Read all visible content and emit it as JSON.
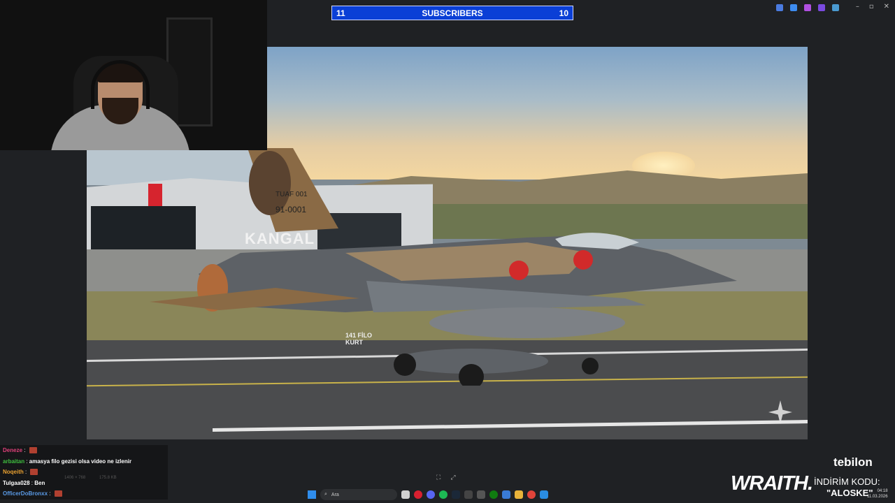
{
  "subscriber_bar": {
    "left_value": "11",
    "title": "SUBSCRIBERS",
    "right_value": "10",
    "bg_color": "#0a3fd6"
  },
  "top_icons": [
    "app-icon",
    "app-icon",
    "app-icon",
    "app-icon",
    "app-icon"
  ],
  "window_controls": {
    "minimize": "–",
    "maximize": "▫",
    "close": "✕"
  },
  "photo": {
    "tail_text_1": "TUAF 001",
    "tail_text_2": "91-0001",
    "nose_name": "KANGAL",
    "squadron_text_1": "141 FİLO",
    "squadron_text_2": "KURT"
  },
  "chat": {
    "messages": [
      {
        "user": "Deneze",
        "user_color": "#e0407a",
        "text": "",
        "emote": true
      },
      {
        "user": "arbaitan",
        "user_color": "#3fbf3f",
        "text": "amasya filo gezisi olsa video ne izlenir",
        "emote": false
      },
      {
        "user": "Noqeith",
        "user_color": "#e8a030",
        "text": "",
        "emote": true
      },
      {
        "user": "Tulgaa028",
        "user_color": "#ffffff",
        "text": "Ben",
        "emote": false
      },
      {
        "user": "OfficerDoBronxx",
        "user_color": "#5a9ae6",
        "text": "",
        "emote": true
      }
    ]
  },
  "viewer_status": {
    "dimensions": "1406 × 768",
    "size": "175.8 KB"
  },
  "taskbar": {
    "search_placeholder": "Ara"
  },
  "sponsor": {
    "brand_top": "tebilon",
    "brand_main": "WRAITH.",
    "discount_label": "İNDİRİM KODU:",
    "discount_code": "\"ALOSKE\""
  },
  "clock": {
    "time": "04:18",
    "date": "11.03.2026"
  }
}
